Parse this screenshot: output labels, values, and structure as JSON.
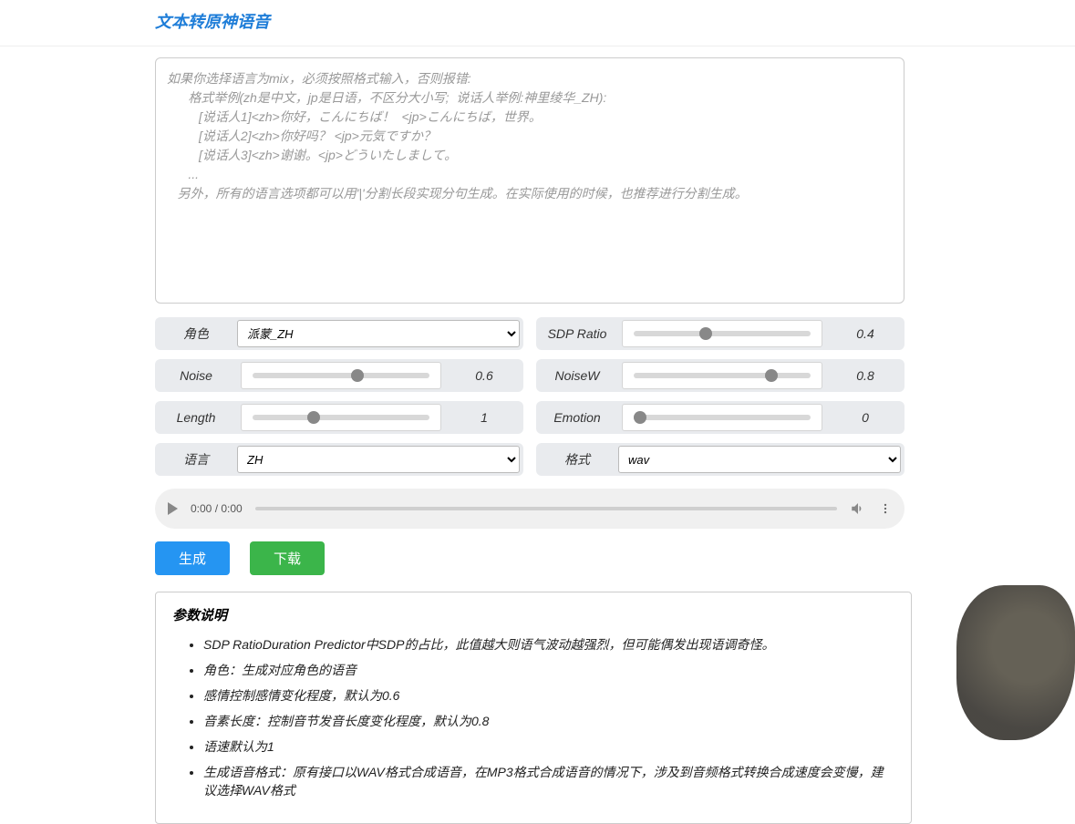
{
  "title": "文本转原神语音",
  "textarea_placeholder": "如果你选择语言为mix，必须按照格式输入，否则报错:\n      格式举例(zh是中文，jp是日语，不区分大小写;  说话人举例:神里绫华_ZH):\n         [说话人1]<zh>你好，こんにちば！  <jp>こんにちば，世界。\n         [说话人2]<zh>你好吗？ <jp>元気ですか？\n         [说话人3]<zh>谢谢。<jp>どういたしまして。\n      ...\n   另外，所有的语言选项都可以用'|'分割长段实现分句生成。在实际使用的时候，也推荐进行分割生成。",
  "controls": {
    "role_label": "角色",
    "role_value": "派蒙_ZH",
    "sdp_label": "SDP Ratio",
    "sdp_value": "0.4",
    "noise_label": "Noise",
    "noise_value": "0.6",
    "noisew_label": "NoiseW",
    "noisew_value": "0.8",
    "length_label": "Length",
    "length_value": "1",
    "emotion_label": "Emotion",
    "emotion_value": "0",
    "lang_label": "语言",
    "lang_value": "ZH",
    "format_label": "格式",
    "format_value": "wav"
  },
  "audio": {
    "time": "0:00 / 0:00"
  },
  "buttons": {
    "generate": "生成",
    "download": "下载"
  },
  "info": {
    "heading": "参数说明",
    "items": [
      "SDP RatioDuration Predictor中SDP的占比，此值越大则语气波动越强烈，但可能偶发出现语调奇怪。",
      "角色：生成对应角色的语音",
      "感情控制感情变化程度，默认为0.6",
      "音素长度：控制音节发音长度变化程度，默认为0.8",
      "语速默认为1",
      "生成语音格式：原有接口以WAV格式合成语音，在MP3格式合成语音的情况下，涉及到音频格式转换合成速度会变慢，建议选择WAV格式"
    ]
  }
}
